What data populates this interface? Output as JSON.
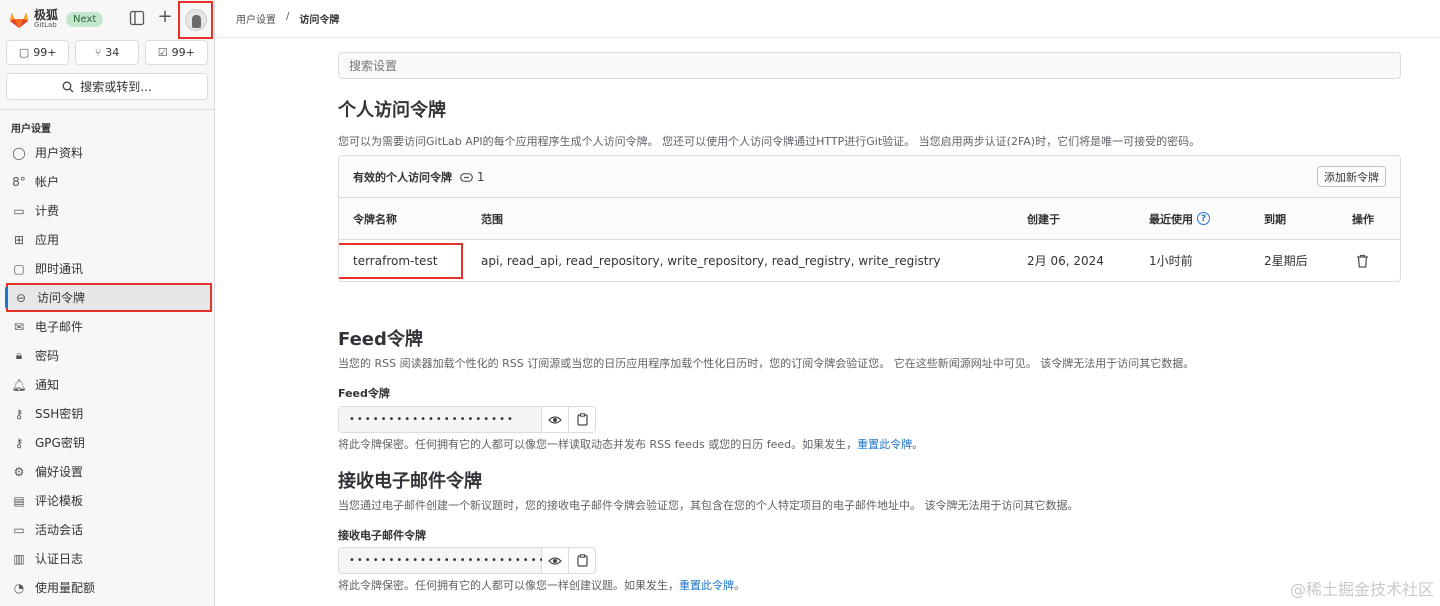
{
  "brand": {
    "name_cn": "极狐",
    "name_en": "GitLab",
    "badge": "Next"
  },
  "counters": {
    "issues": "99+",
    "merge_requests": "34",
    "todos": "99+"
  },
  "search": {
    "label": "搜索或转到..."
  },
  "sidebar": {
    "section_title": "用户设置",
    "items": [
      {
        "label": "用户资料",
        "icon": "profile-icon"
      },
      {
        "label": "帐户",
        "icon": "account-icon"
      },
      {
        "label": "计费",
        "icon": "billing-icon"
      },
      {
        "label": "应用",
        "icon": "applications-icon"
      },
      {
        "label": "即时通讯",
        "icon": "chat-icon"
      },
      {
        "label": "访问令牌",
        "icon": "token-icon"
      },
      {
        "label": "电子邮件",
        "icon": "mail-icon"
      },
      {
        "label": "密码",
        "icon": "lock-icon"
      },
      {
        "label": "通知",
        "icon": "bell-icon"
      },
      {
        "label": "SSH密钥",
        "icon": "key-icon"
      },
      {
        "label": "GPG密钥",
        "icon": "key-icon"
      },
      {
        "label": "偏好设置",
        "icon": "preferences-icon"
      },
      {
        "label": "评论模板",
        "icon": "comment-icon"
      },
      {
        "label": "活动会话",
        "icon": "monitor-icon"
      },
      {
        "label": "认证日志",
        "icon": "log-icon"
      },
      {
        "label": "使用量配额",
        "icon": "quota-icon"
      }
    ]
  },
  "breadcrumb": {
    "parent": "用户设置",
    "separator": "/",
    "current": "访问令牌"
  },
  "main": {
    "search_placeholder": "搜索设置",
    "pat": {
      "title": "个人访问令牌",
      "description": "您可以为需要访问GitLab API的每个应用程序生成个人访问令牌。 您还可以使用个人访问令牌通过HTTP进行Git验证。 当您启用两步认证(2FA)时，它们将是唯一可接受的密码。",
      "card_title": "有效的个人访问令牌",
      "count": "1",
      "add_button": "添加新令牌",
      "columns": {
        "name": "令牌名称",
        "scope": "范围",
        "created": "创建于",
        "last_used": "最近使用",
        "expires": "到期",
        "actions": "操作"
      },
      "rows": [
        {
          "name": "terrafrom-test",
          "scope": "api, read_api, read_repository, write_repository, read_registry, write_registry",
          "created": "2月 06, 2024",
          "last_used": "1小时前",
          "expires": "2星期后"
        }
      ]
    },
    "feed": {
      "title": "Feed令牌",
      "description": "当您的 RSS 阅读器加载个性化的 RSS 订阅源或当您的日历应用程序加载个性化日历时，您的订阅令牌会验证您。 它在这些新闻源网址中可见。 该令牌无法用于访问其它数据。",
      "label": "Feed令牌",
      "masked": "•••••••••••••••••••••",
      "help": "将此令牌保密。任何拥有它的人都可以像您一样读取动态并发布 RSS feeds 或您的日历 feed。如果发生，",
      "reset_link": "重置此令牌",
      "help_end": "。"
    },
    "incoming_email": {
      "title": "接收电子邮件令牌",
      "description": "当您通过电子邮件创建一个新议题时，您的接收电子邮件令牌会验证您，其包含在您的个人特定项目的电子邮件地址中。 该令牌无法用于访问其它数据。",
      "label": "接收电子邮件令牌",
      "masked": "••••••••••••••••••••••••••",
      "help": "将此令牌保密。任何拥有它的人都可以像您一样创建议题。如果发生，",
      "reset_link": "重置此令牌",
      "help_end": "。"
    }
  },
  "watermark": "@稀土掘金技术社区",
  "colors": {
    "accent": "#1f75cb",
    "highlight": "#e5332a",
    "brand": "#e24329"
  }
}
